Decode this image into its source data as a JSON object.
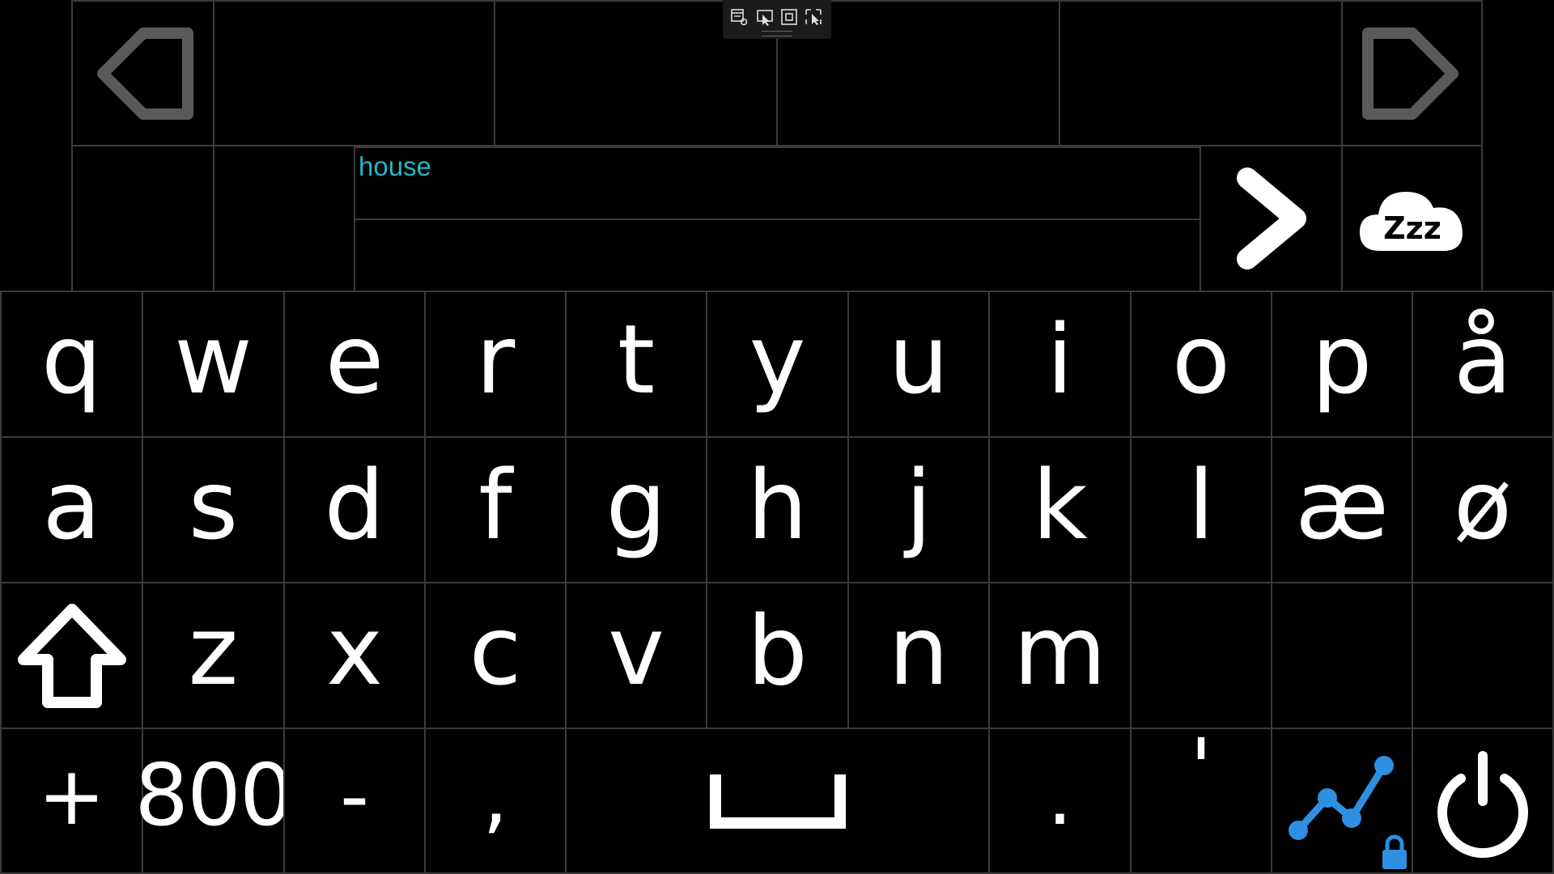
{
  "prediction": {
    "typed_text": "house"
  },
  "icons": {
    "back": "back-arrow-icon",
    "forward": "forward-arrow-icon",
    "next": "chevron-right-icon",
    "sleep": "sleep-cloud-icon",
    "shift": "shift-up-arrow-icon",
    "space": "spacebar-icon",
    "analytics": "line-chart-icon",
    "lock": "lock-icon",
    "power": "power-icon"
  },
  "keyboard": {
    "row1": [
      "q",
      "w",
      "e",
      "r",
      "t",
      "y",
      "u",
      "i",
      "o",
      "p",
      "å"
    ],
    "row2": [
      "a",
      "s",
      "d",
      "f",
      "g",
      "h",
      "j",
      "k",
      "l",
      "æ",
      "ø"
    ],
    "row3": [
      "z",
      "x",
      "c",
      "v",
      "b",
      "n",
      "m"
    ],
    "row4": {
      "plus": "+",
      "number": "800",
      "minus": "-",
      "comma": ",",
      "period": ".",
      "apostrophe": "'"
    }
  },
  "colors": {
    "background": "#000000",
    "grid": "#3a3a3a",
    "key_text": "#ffffff",
    "nav_arrow": "#5a5a5a",
    "typed_text": "#22b8c8",
    "accent_blue": "#2f8fe0"
  }
}
